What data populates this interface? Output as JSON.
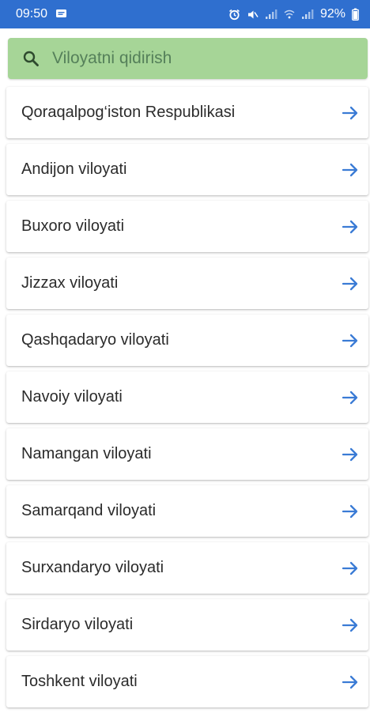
{
  "status_bar": {
    "time": "09:50",
    "battery": "92%",
    "icons": [
      "message-icon",
      "alarm-icon",
      "mute-icon",
      "signal-icon",
      "wifi-icon",
      "signal-icon",
      "battery-icon"
    ]
  },
  "search": {
    "placeholder": "Viloyatni qidirish",
    "value": ""
  },
  "regions": [
    {
      "label": "Qoraqalpog‘iston Respublikasi"
    },
    {
      "label": "Andijon viloyati"
    },
    {
      "label": "Buxoro viloyati"
    },
    {
      "label": "Jizzax viloyati"
    },
    {
      "label": "Qashqadaryo viloyati"
    },
    {
      "label": "Navoiy viloyati"
    },
    {
      "label": "Namangan viloyati"
    },
    {
      "label": "Samarqand viloyati"
    },
    {
      "label": "Surxandaryo viloyati"
    },
    {
      "label": "Sirdaryo viloyati"
    },
    {
      "label": "Toshkent viloyati"
    }
  ],
  "colors": {
    "status_bar": "#2f6fcf",
    "search_bg": "#a6d597",
    "arrow": "#3a7bd5",
    "text": "#2b2b2b"
  }
}
